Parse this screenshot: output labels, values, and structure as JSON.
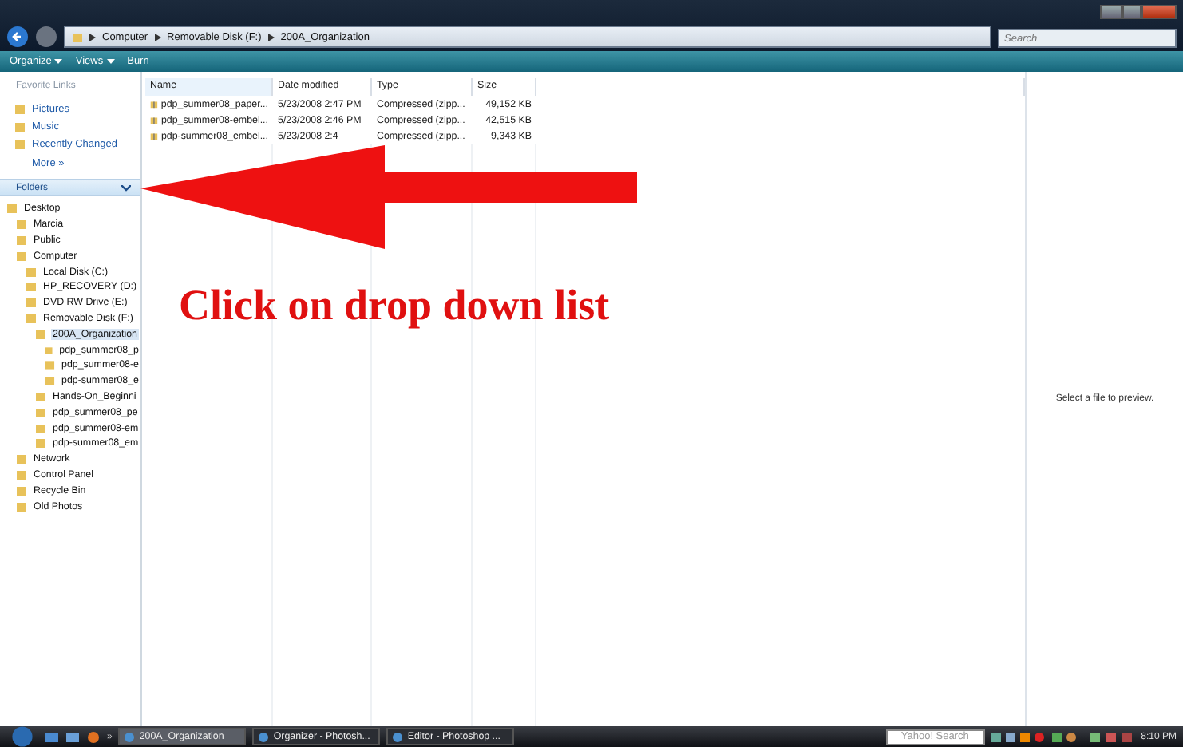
{
  "address_bar": {
    "crumbs": [
      "Computer",
      "Removable Disk (F:)",
      "200A_Organization"
    ],
    "search_placeholder": "Search"
  },
  "toolbar": {
    "buttons": [
      {
        "label": "Organize",
        "kind": "menu"
      },
      {
        "label": "Views",
        "kind": "menu"
      },
      {
        "label": "Burn",
        "kind": "plain"
      }
    ]
  },
  "favorite_links": {
    "heading": "Favorite Links",
    "items": [
      "Pictures",
      "Music",
      "Recently Changed"
    ],
    "more": "More »"
  },
  "folders_header": {
    "label": "Folders",
    "expanded": true
  },
  "folder_tree": [
    {
      "label": "Desktop",
      "selected": false,
      "children": [
        {
          "label": "Marcia",
          "selected": false
        },
        {
          "label": "Public",
          "selected": false
        },
        {
          "label": "Computer",
          "selected": false,
          "children": [
            {
              "label": "Local Disk (C:)",
              "selected": false
            },
            {
              "label": "HP_RECOVERY (D:)",
              "selected": false
            },
            {
              "label": "DVD RW Drive (E:)",
              "selected": false
            },
            {
              "label": "Removable Disk (F:)",
              "selected": false,
              "children": [
                {
                  "label": "200A_Organization",
                  "selected": true,
                  "children": [
                    {
                      "label": "pdp_summer08_p",
                      "selected": false
                    },
                    {
                      "label": "pdp_summer08-e",
                      "selected": false
                    },
                    {
                      "label": "pdp-summer08_e",
                      "selected": false
                    }
                  ]
                },
                {
                  "label": "Hands-On_Beginni",
                  "selected": false
                },
                {
                  "label": "pdp_summer08_pe",
                  "selected": false
                },
                {
                  "label": "pdp_summer08-em",
                  "selected": false
                },
                {
                  "label": "pdp-summer08_em",
                  "selected": false
                }
              ]
            }
          ]
        },
        {
          "label": "Network",
          "selected": false
        },
        {
          "label": "Control Panel",
          "selected": false
        },
        {
          "label": "Recycle Bin",
          "selected": false
        },
        {
          "label": "Old Photos",
          "selected": false
        }
      ]
    }
  ],
  "table": {
    "columns": [
      "Name",
      "Date modified",
      "Type",
      "Size"
    ],
    "rows": [
      {
        "name": "pdp_summer08_paper...",
        "date": "5/23/2008 2:47 PM",
        "type": "Compressed (zipp...",
        "size": "49,152 KB"
      },
      {
        "name": "pdp_summer08-embel...",
        "date": "5/23/2008 2:46 PM",
        "type": "Compressed (zipp...",
        "size": "42,515 KB"
      },
      {
        "name": "pdp-summer08_embel...",
        "date": "5/23/2008 2:4",
        "type": "Compressed (zipp...",
        "size": "9,343 KB"
      }
    ]
  },
  "preview": {
    "message": "Select a file to preview."
  },
  "annotation": {
    "text": "Click on drop down list"
  },
  "taskbar": {
    "more": "»",
    "tasks": [
      {
        "label": "200A_Organization",
        "selected": true
      },
      {
        "label": "Organizer - Photosh...",
        "selected": false
      },
      {
        "label": "Editor - Photoshop ...",
        "selected": false
      }
    ],
    "search": "Yahoo! Search",
    "clock": "8:10 PM"
  }
}
